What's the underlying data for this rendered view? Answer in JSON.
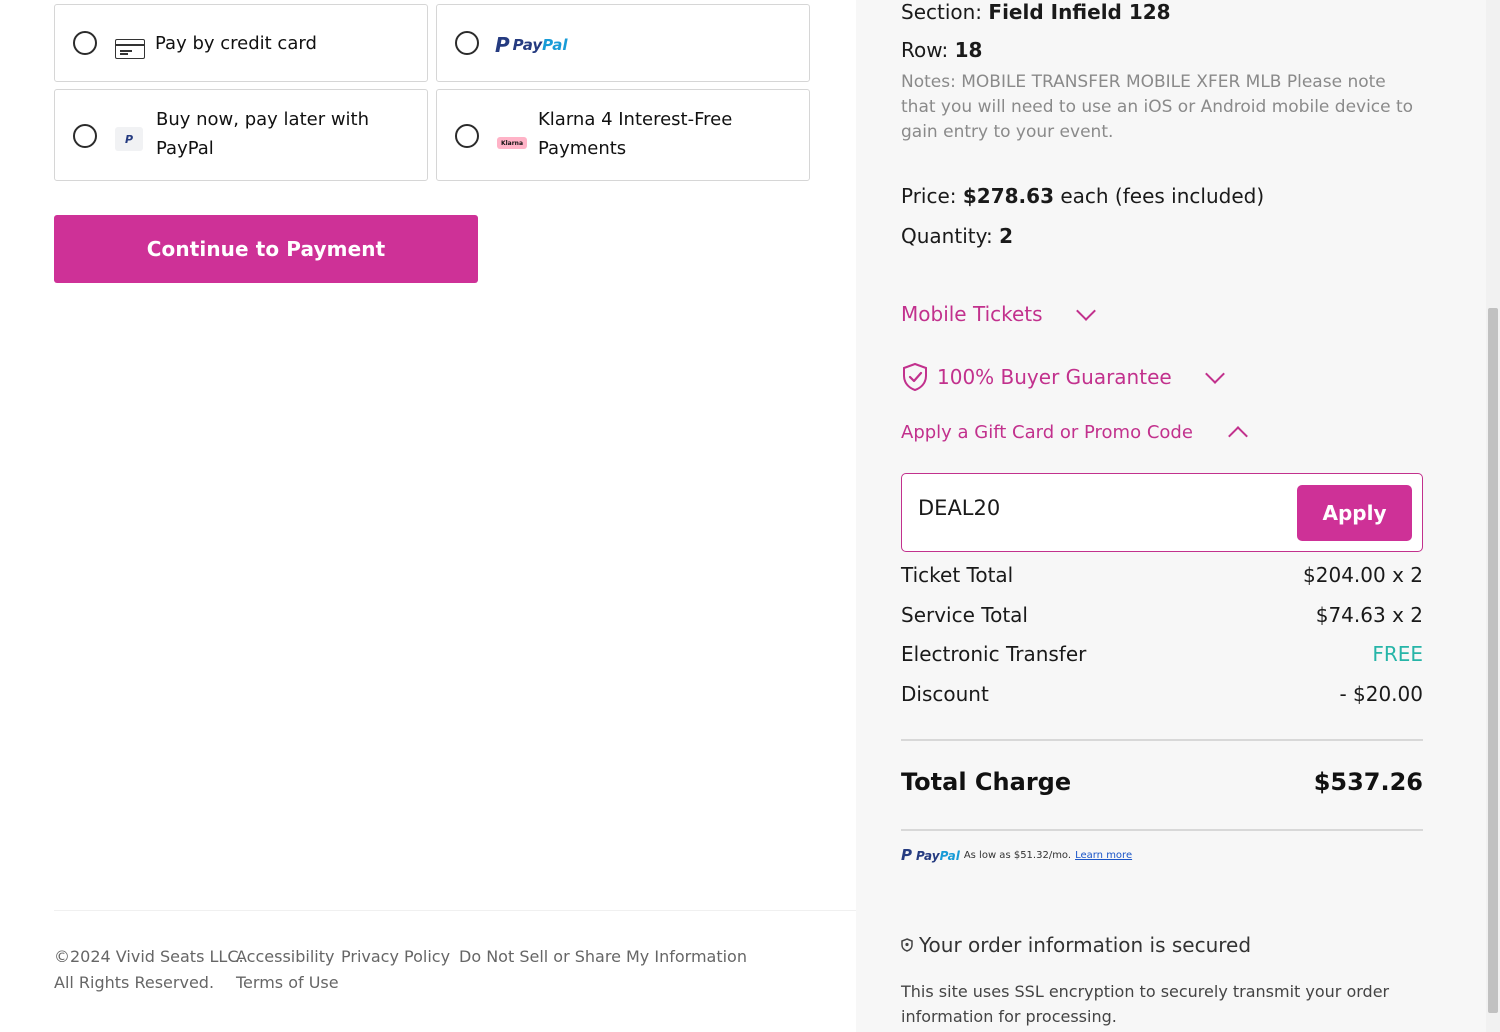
{
  "payment_options": [
    {
      "label": "Pay by credit card",
      "icon": "credit-card-icon"
    },
    {
      "label": "PayPal",
      "icon": "paypal-logo"
    },
    {
      "label": "Buy now, pay later with PayPal",
      "icon": "paypal-small-icon"
    },
    {
      "label": "Klarna 4 Interest-Free Payments",
      "icon": "klarna-icon"
    }
  ],
  "paypal_logo": {
    "pay": "Pay",
    "pal": "Pal",
    "p": "P"
  },
  "klarna_badge": "Klarna",
  "continue_label": "Continue to Payment",
  "footer": {
    "copyright": "©2024 Vivid Seats LLC.",
    "rights": "All Rights Reserved.",
    "accessibility": "Accessibility",
    "privacy": "Privacy Policy",
    "do_not_sell": "Do Not Sell or Share My Information",
    "terms": "Terms of Use"
  },
  "order": {
    "section_label": "Section:",
    "section_value": "Field Infield 128",
    "row_label": "Row:",
    "row_value": "18",
    "notes": "Notes: MOBILE TRANSFER MOBILE XFER MLB Please note that you will need to use an iOS or Android mobile device to gain entry to your event.",
    "price_label": "Price:",
    "price_value": "$278.63",
    "price_suffix": "each (fees included)",
    "quantity_label": "Quantity:",
    "quantity_value": "2"
  },
  "toggles": {
    "mobile_tickets": "Mobile Tickets",
    "buyer_guarantee": "100% Buyer Guarantee",
    "promo": "Apply a Gift Card or Promo Code"
  },
  "promo": {
    "value": "DEAL20",
    "apply_label": "Apply"
  },
  "summary": [
    {
      "label": "Ticket Total",
      "value": "$204.00 x 2"
    },
    {
      "label": "Service Total",
      "value": "$74.63 x 2"
    },
    {
      "label": "Electronic Transfer",
      "value": "FREE"
    },
    {
      "label": "Discount",
      "value": "- $20.00"
    }
  ],
  "total": {
    "label": "Total Charge",
    "value": "$537.26"
  },
  "paypal_credit": {
    "text": "As low as $51.32/mo.",
    "link": "Learn more"
  },
  "secured": {
    "title": "Your order information is secured",
    "body": "This site uses SSL encryption to securely transmit your order information for processing."
  },
  "colors": {
    "accent": "#ce3197",
    "free": "#26b5a8",
    "paypal_dark": "#253b80",
    "paypal_light": "#179bd7"
  }
}
